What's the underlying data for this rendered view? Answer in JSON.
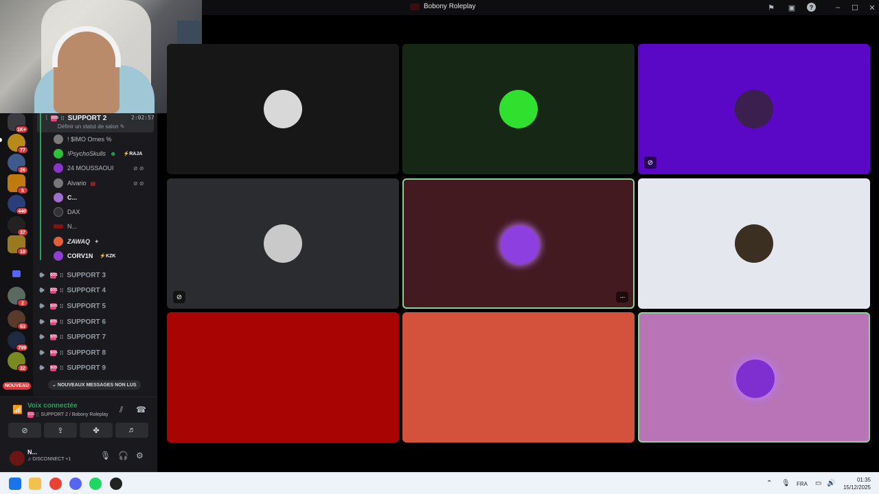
{
  "window": {
    "title": "Bobony Roleplay"
  },
  "titlebar_icons": [
    "inbox-flag-icon",
    "screen-share-icon",
    "help-icon",
    "minimize-icon",
    "maximize-icon",
    "close-icon"
  ],
  "servers": [
    {
      "badge": "1K+"
    },
    {
      "badge": "77"
    },
    {
      "badge": "26"
    },
    {
      "badge": "5"
    },
    {
      "badge": "440"
    },
    {
      "badge": "37"
    },
    {
      "badge": "10"
    },
    {
      "badge": "2"
    },
    {
      "badge": "63"
    },
    {
      "badge": "799"
    },
    {
      "badge": "32"
    }
  ],
  "nouveau": "NOUVEAU",
  "active_channel": {
    "name": "SUPPORT 2",
    "timer": "2:02:57",
    "status": "Définir un statut de salon"
  },
  "voice_users": [
    {
      "name": "! $IMO Ornes %",
      "tag": "",
      "color": "#7a7a7a"
    },
    {
      "name": "!PsychoSkulls",
      "tag": "RAJA",
      "color": "#2fbf3a"
    },
    {
      "name": "24 MOUSSAOUI",
      "tag": "",
      "color": "#8b34c9"
    },
    {
      "name": "Alvario",
      "tag": "",
      "color": "#777777"
    },
    {
      "name": "C...",
      "tag": "",
      "color": "#a070d0"
    },
    {
      "name": "DAX",
      "tag": "",
      "color": "#333333"
    },
    {
      "name": "N...",
      "tag": "",
      "color": "#8a1010"
    },
    {
      "name": "ZAWAQ",
      "tag": "",
      "color": "#e0603c"
    },
    {
      "name": "CORV1N",
      "tag": "KZK",
      "color": "#8e3fd0"
    }
  ],
  "other_channels": [
    "SUPPORT 3",
    "SUPPORT 4",
    "SUPPORT 5",
    "SUPPORT 6",
    "SUPPORT 7",
    "SUPPORT 8",
    "SUPPORT 9"
  ],
  "new_messages_label": "NOUVEAUX MESSAGES NON LUS",
  "voice_status": {
    "title": "Voix connectée",
    "subtitle": "SUPPORT 2 / Bobony Roleplay"
  },
  "current_user": {
    "name": "N...",
    "status": "DISCONNECT +1"
  },
  "tiles": [
    {
      "bg": "#171717",
      "avatar": "#d8d8d8",
      "speaking": false,
      "cam_off_icon": false,
      "menu": false
    },
    {
      "bg": "#172715",
      "avatar": "#2fe02f",
      "speaking": false,
      "cam_off_icon": false,
      "menu": false
    },
    {
      "bg": "#5a07c6",
      "avatar": "#3a1f4f",
      "speaking": false,
      "cam_off_icon": true,
      "menu": false
    },
    {
      "bg": "#2b2c30",
      "avatar": "#c9c9c9",
      "speaking": false,
      "cam_off_icon": true,
      "menu": false
    },
    {
      "bg": "#441a21",
      "avatar": "#8d3fe0",
      "speaking": true,
      "cam_off_icon": false,
      "menu": true
    },
    {
      "bg": "#e4e8ee",
      "avatar": "#3a2f20",
      "speaking": false,
      "cam_off_icon": false,
      "menu": false
    },
    {
      "bg": "#a80404",
      "avatar": "#a80404",
      "speaking": false,
      "cam_off_icon": false,
      "menu": false
    },
    {
      "bg": "#d4513c",
      "avatar": "#d4513c",
      "speaking": false,
      "cam_off_icon": false,
      "menu": false
    },
    {
      "bg": "#b874b7",
      "avatar": "#7f2fcf",
      "speaking": true,
      "cam_off_icon": false,
      "menu": false
    }
  ],
  "tile_menu_label": "···",
  "taskbar": {
    "language": "FRA",
    "time": "01:35",
    "date": "15/12/2025"
  }
}
